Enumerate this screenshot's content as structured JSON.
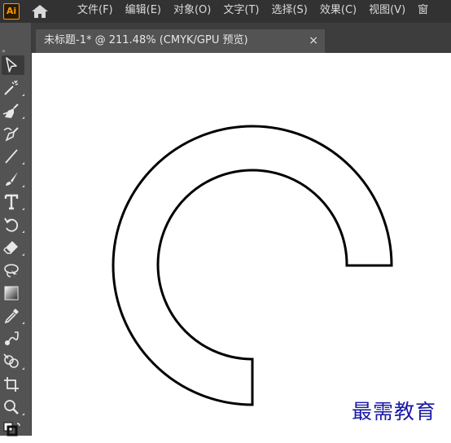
{
  "app": {
    "logo_text": "Ai",
    "logo_color": "#ff9a00"
  },
  "menubar": {
    "items": [
      "文件(F)",
      "编辑(E)",
      "对象(O)",
      "文字(T)",
      "选择(S)",
      "效果(C)",
      "视图(V)",
      "窗"
    ]
  },
  "toolbar": {
    "collapse_glyph": "»",
    "tools": [
      "selection-tool",
      "magic-wand-tool",
      "pen-tool",
      "curvature-tool",
      "line-segment-tool",
      "paintbrush-tool",
      "type-tool",
      "rotate-tool",
      "eraser-tool",
      "lasso-tool",
      "gradient-tool",
      "eyedropper-tool",
      "blend-tool",
      "shape-builder-tool",
      "artboard-tool",
      "zoom-tool"
    ]
  },
  "tab": {
    "title": "未标题-1* @ 211.48% (CMYK/GPU 预览)",
    "close_glyph": "×"
  },
  "watermark": {
    "text": "最需教育"
  }
}
